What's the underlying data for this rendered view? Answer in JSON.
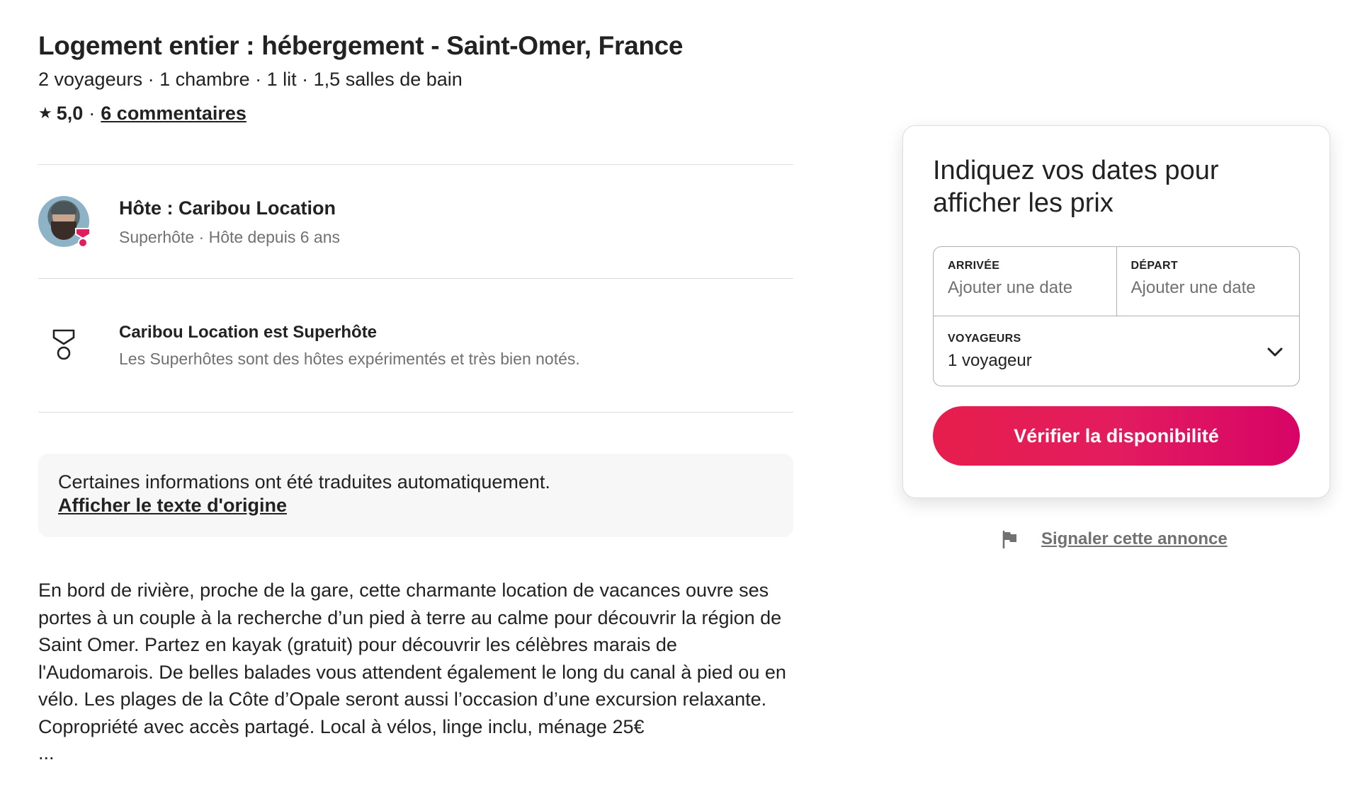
{
  "listing": {
    "title": "Logement entier : hébergement - Saint-Omer, France",
    "details": "2 voyageurs · 1 chambre · 1 lit · 1,5 salles de bain",
    "rating": "5,0",
    "separator": "·",
    "reviews_link": "6 commentaires"
  },
  "host": {
    "name": "Hôte : Caribou Location",
    "meta": "Superhôte · Hôte depuis 6 ans"
  },
  "superhost": {
    "title": "Caribou Location est Superhôte",
    "description": "Les Superhôtes sont des hôtes expérimentés et très bien notés."
  },
  "translation": {
    "notice": "Certaines informations ont été traduites automatiquement.",
    "link": "Afficher le texte d'origine"
  },
  "description": {
    "text": "En bord de rivière, proche de la gare, cette charmante location de vacances ouvre ses portes à un couple à la recherche d’un pied à terre au calme pour découvrir la région de Saint Omer. Partez en kayak (gratuit) pour découvrir les célèbres marais de l'Audomarois. De belles balades vous attendent également le long du canal à pied ou en vélo. Les plages de la Côte d’Opale seront aussi l’occasion d’une excursion relaxante. Copropriété avec accès partagé. Local à vélos, linge inclu, ménage 25€",
    "ellipsis": "..."
  },
  "booking": {
    "title": "Indiquez vos dates pour afficher les prix",
    "checkin_label": "ARRIVÉE",
    "checkin_value": "Ajouter une date",
    "checkout_label": "DÉPART",
    "checkout_value": "Ajouter une date",
    "guests_label": "VOYAGEURS",
    "guests_value": "1 voyageur",
    "cta": "Vérifier la disponibilité"
  },
  "report": {
    "link": "Signaler cette annonce"
  },
  "colors": {
    "brand": "#e61e4d",
    "brand_end": "#d70466",
    "text": "#222222",
    "muted": "#717171",
    "divider": "#dddddd"
  },
  "icons": [
    "star-icon",
    "superhost-badge-icon",
    "chevron-down-icon",
    "flag-icon"
  ]
}
